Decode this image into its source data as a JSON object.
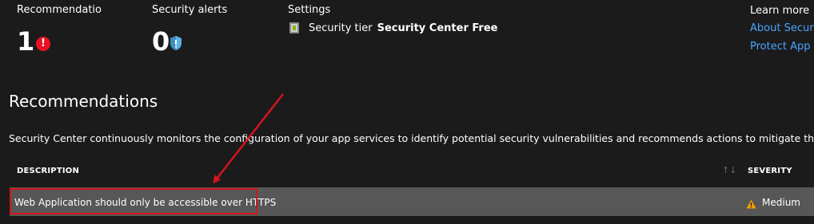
{
  "stats": {
    "recommendations": {
      "title": "Recommendatio",
      "count": "1",
      "badge_symbol": "!"
    },
    "security_alerts": {
      "title": "Security alerts",
      "count": "0"
    }
  },
  "settings": {
    "title": "Settings",
    "tier_label": "Security tier",
    "tier_value": "Security Center Free"
  },
  "learn_more": {
    "title": "Learn more",
    "links": [
      "About Security",
      "Protect App s"
    ]
  },
  "recommendations_section": {
    "title": "Recommendations",
    "description": "Security Center continuously monitors the configuration of your app services to identify potential security vulnerabilities and recommends actions to mitigate them.",
    "columns": {
      "description": "DESCRIPTION",
      "severity": "SEVERITY"
    },
    "rows": [
      {
        "description": "Web Application should only be accessible over HTTPS",
        "severity": "Medium"
      }
    ]
  },
  "colors": {
    "background": "#1b1b1c",
    "link": "#4aa3ff",
    "error_badge": "#e81123",
    "shield": "#5ab4e6",
    "warning": "#f2a100",
    "annotation_red": "#d5151a",
    "row_highlight": "#575757"
  },
  "icons": {
    "recommendation_badge": "error-badge-icon",
    "alert_badge": "shield-icon",
    "tier": "security-tier-icon",
    "severity": "warning-icon",
    "sort": "sort-icon"
  }
}
